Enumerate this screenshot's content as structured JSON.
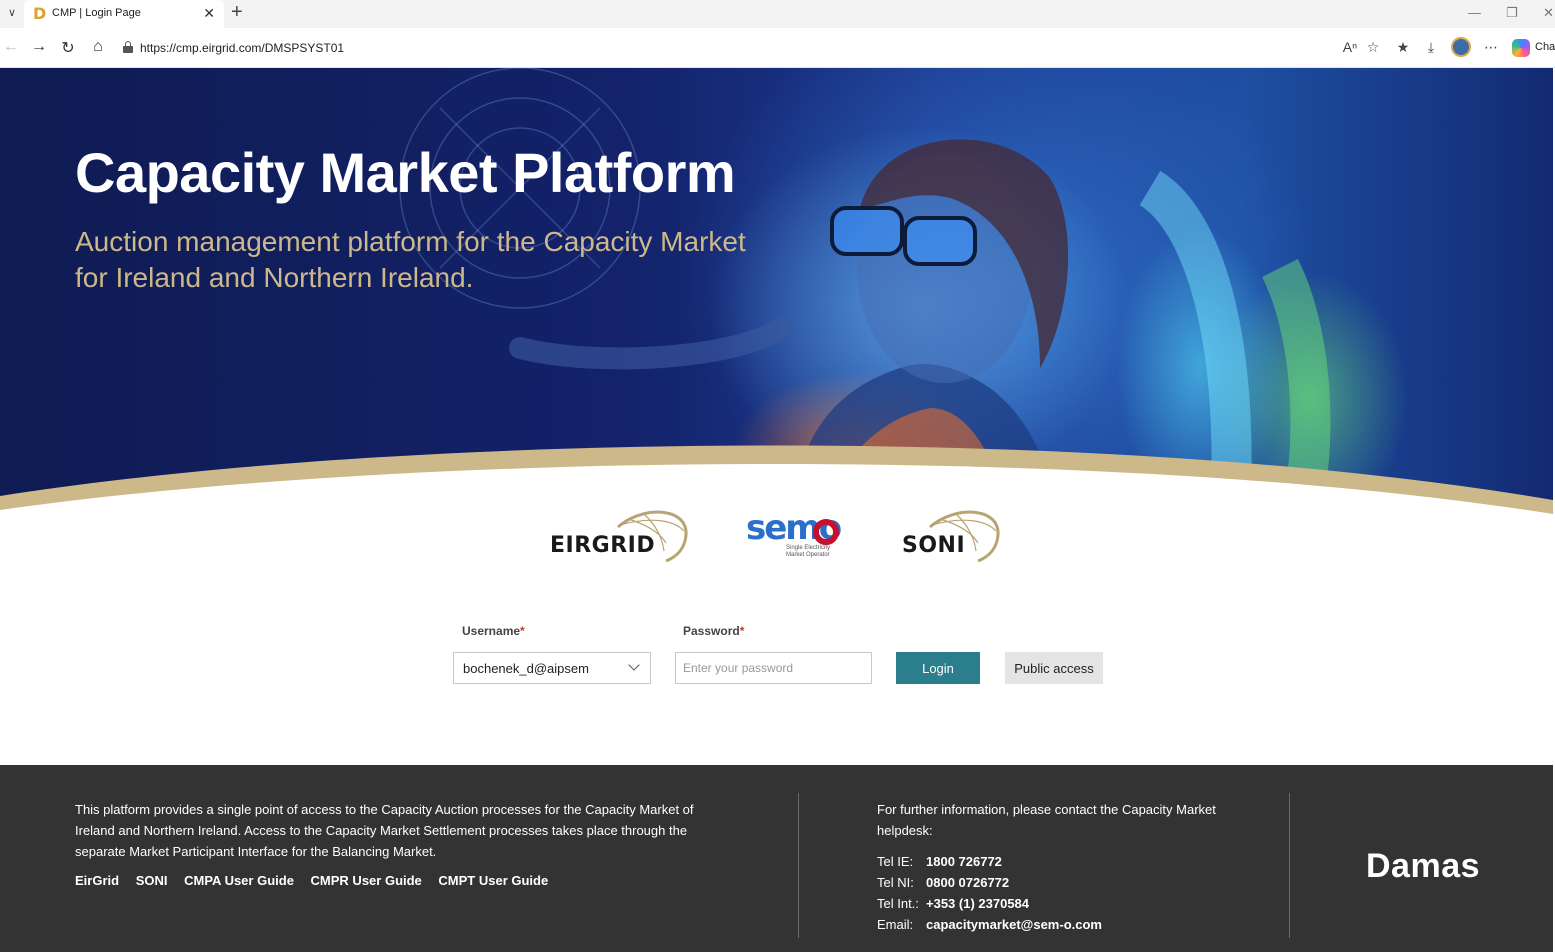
{
  "browser": {
    "tab_title": "CMP | Login Page",
    "favicon_letter": "D",
    "url": "https://cmp.eirgrid.com/DMSPSYST01",
    "chat_label": "Chat",
    "icons": [
      "tab-list-icon",
      "close-icon",
      "new-tab-icon",
      "minimize-icon",
      "restore-icon",
      "window-close-icon",
      "back-icon",
      "forward-icon",
      "reload-icon",
      "home-icon",
      "lock-icon",
      "read-aloud-icon",
      "favorite-icon",
      "favorites-list-icon",
      "download-icon",
      "avatar",
      "more-icon",
      "copilot-icon"
    ]
  },
  "hero": {
    "title": "Capacity Market Platform",
    "subtitle": "Auction management platform for the Capacity Market for Ireland and Northern Ireland."
  },
  "logos": {
    "eirgrid": "EIRGRID",
    "semo": "semo",
    "semo_tagline_1": "Single Electricity",
    "semo_tagline_2": "Market Operator",
    "soni": "SONI"
  },
  "login": {
    "username_label": "Username",
    "password_label": "Password",
    "required_mark": "*",
    "username_value": "bochenek_d@aipsem",
    "password_placeholder": "Enter your password",
    "login_button": "Login",
    "public_access_button": "Public access"
  },
  "footer": {
    "description": "This platform provides a single point of access to the Capacity Auction processes for the Capacity Market of Ireland and Northern Ireland. Access to the Capacity Market Settlement processes takes place through the separate Market Participant Interface for the Balancing Market.",
    "links": [
      "EirGrid",
      "SONI",
      "CMPA User Guide",
      "CMPR User Guide",
      "CMPT User Guide"
    ],
    "contact_intro": "For further information, please contact the Capacity Market helpdesk:",
    "contacts": [
      {
        "label": "Tel IE:",
        "value": "1800 726772"
      },
      {
        "label": "Tel NI:",
        "value": "0800 0726772"
      },
      {
        "label": "Tel Int.:",
        "value": "+353 (1) 2370584"
      },
      {
        "label": "Email:",
        "value": "capacitymarket@sem-o.com"
      }
    ],
    "brand": "Damas"
  },
  "colors": {
    "hero_dark_blue": "#13226a",
    "gold_accent": "#cdb88a",
    "login_button": "#2b7f8c",
    "required": "#c0392b",
    "footer_bg": "#333333",
    "semo_blue": "#2a6fc9",
    "semo_red": "#c4112f"
  }
}
